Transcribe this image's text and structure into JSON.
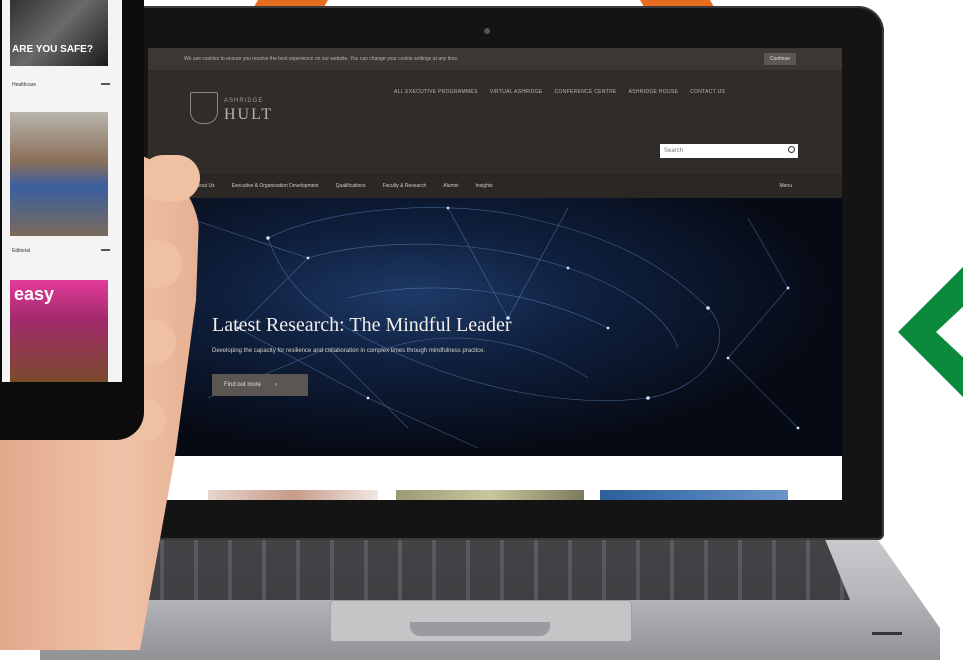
{
  "colors": {
    "accent_orange": "#e86d1f",
    "accent_green": "#0b8a3c",
    "site_header": "#2f2c2a",
    "hero_button": "#5b5652"
  },
  "site": {
    "cookie_banner": {
      "text": "We use cookies to ensure you receive the best experience on our website. You can change your cookie settings at any time.",
      "button": "Continue"
    },
    "logo": {
      "small": "ASHRIDGE",
      "large": "HULT"
    },
    "utility_nav": [
      "ALL EXECUTIVE PROGRAMMES",
      "VIRTUAL ASHRIDGE",
      "CONFERENCE CENTRE",
      "ASHRIDGE HOUSE",
      "CONTACT US"
    ],
    "search": {
      "placeholder": "Search"
    },
    "main_nav": [
      "About Us",
      "Executive & Organisation Development",
      "Qualifications",
      "Faculty & Research",
      "Alumni",
      "Insights",
      "Menu"
    ],
    "hero": {
      "title": "Latest Research: The Mindful Leader",
      "subtitle": "Developing the capacity for resilience and collaboration in complex times through mindfulness practice.",
      "button": "Find out more"
    }
  },
  "phone": {
    "items": [
      {
        "cover_text": "ARE YOU SAFE?",
        "label": "Healthcare"
      },
      {
        "cover_text": "",
        "label": "Editorial"
      },
      {
        "cover_text": "easy",
        "label": ""
      }
    ]
  },
  "icons": {
    "download": "download-icon",
    "search": "search-icon",
    "chevron": "chevron-left-icon"
  }
}
